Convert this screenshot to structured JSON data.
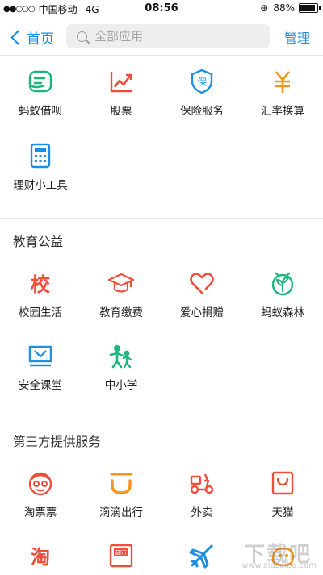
{
  "status_bar": {
    "signal": "●●○○○",
    "carrier": "中国移动",
    "network": "4G",
    "time": "08:56",
    "battery_pct": "88%",
    "battery_level": 0.88
  },
  "nav": {
    "back_label": "首页",
    "search_placeholder": "全部应用",
    "manage_label": "管理"
  },
  "finance_items": [
    {
      "label": "蚂蚁借呗",
      "icon": "ant-borrow-icon",
      "color": "#1fb57f"
    },
    {
      "label": "股票",
      "icon": "stock-chart-icon",
      "color": "#f04d3b"
    },
    {
      "label": "保险服务",
      "icon": "insurance-shield-icon",
      "color": "#1a8fe3"
    },
    {
      "label": "汇率换算",
      "icon": "yuan-exchange-icon",
      "color": "#f7941d"
    },
    {
      "label": "理财小工具",
      "icon": "calculator-icon",
      "color": "#1a8fe3"
    }
  ],
  "education": {
    "title": "教育公益",
    "items": [
      {
        "label": "校园生活",
        "icon": "school-char-icon",
        "glyph": "校",
        "color": "#f04d3b"
      },
      {
        "label": "教育缴费",
        "icon": "graduation-cap-icon",
        "color": "#f04d3b"
      },
      {
        "label": "爱心捐赠",
        "icon": "heart-icon",
        "color": "#f04d3b"
      },
      {
        "label": "蚂蚁森林",
        "icon": "sprout-icon",
        "color": "#1fb57f"
      },
      {
        "label": "安全课堂",
        "icon": "safety-classroom-icon",
        "color": "#1a8fe3"
      },
      {
        "label": "中小学",
        "icon": "kids-icon",
        "color": "#1fb57f"
      }
    ]
  },
  "third_party": {
    "title": "第三方提供服务",
    "items": [
      {
        "label": "淘票票",
        "icon": "taopiaopiao-icon",
        "color": "#f04d3b"
      },
      {
        "label": "滴滴出行",
        "icon": "didi-icon",
        "color": "#f7941d"
      },
      {
        "label": "外卖",
        "icon": "scooter-icon",
        "color": "#f04d3b"
      },
      {
        "label": "天猫",
        "icon": "tmall-bag-icon",
        "color": "#f04d3b"
      },
      {
        "label": "",
        "icon": "taobao-icon",
        "glyph": "淘",
        "color": "#f04d3b"
      },
      {
        "label": "",
        "icon": "supermarket-icon",
        "glyph": "超市",
        "color": "#f04d3b"
      },
      {
        "label": "",
        "icon": "airplane-icon",
        "color": "#1a8fe3"
      },
      {
        "label": "",
        "icon": "fliggy-icon",
        "color": "#f7941d"
      }
    ]
  },
  "watermark": {
    "big": "下载吧",
    "small": "www.xiazaiba.com"
  }
}
